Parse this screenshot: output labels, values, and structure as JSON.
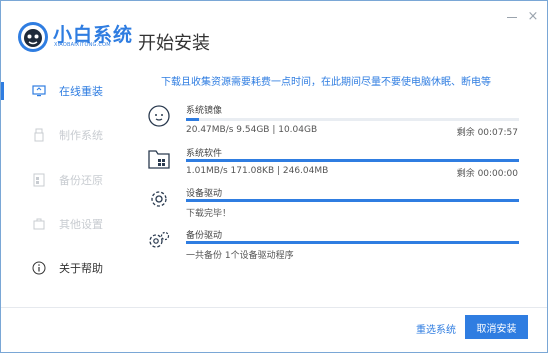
{
  "app": {
    "brand": "小白系统",
    "brand_sub": "XIAOBAIXITONG.COM",
    "page_title": "开始安装"
  },
  "colors": {
    "accent": "#2f7de1",
    "muted": "#c8ccd1"
  },
  "sidebar": {
    "items": [
      {
        "label": "在线重装",
        "icon": "monitor-icon",
        "state": "active"
      },
      {
        "label": "制作系统",
        "icon": "usb-icon",
        "state": "disabled"
      },
      {
        "label": "备份还原",
        "icon": "backup-icon",
        "state": "disabled"
      },
      {
        "label": "其他设置",
        "icon": "settings-box-icon",
        "state": "disabled"
      },
      {
        "label": "关于帮助",
        "icon": "info-icon",
        "state": "normal"
      }
    ]
  },
  "notice": "下载且收集资源需要耗费一点时间，在此期间尽量不要使电脑休眠、断电等",
  "tasks": [
    {
      "name": "系统镜像",
      "icon": "cloud-face-icon",
      "progress": 0.04,
      "info": "20.47MB/s 9.54GB | 10.04GB",
      "eta": "剩余 00:07:57"
    },
    {
      "name": "系统软件",
      "icon": "folder-apps-icon",
      "progress": 1.0,
      "info": "1.01MB/s 171.08KB | 246.04MB",
      "eta": "剩余 00:00:00"
    },
    {
      "name": "设备驱动",
      "icon": "gear-icon",
      "progress": 1.0,
      "info": "下载完毕！",
      "eta": ""
    },
    {
      "name": "备份驱动",
      "icon": "gears-icon",
      "progress": 1.0,
      "info": "一共备份 1个设备驱动程序",
      "eta": ""
    }
  ],
  "footer": {
    "reselect_label": "重选系统",
    "cancel_label": "取消安装"
  }
}
